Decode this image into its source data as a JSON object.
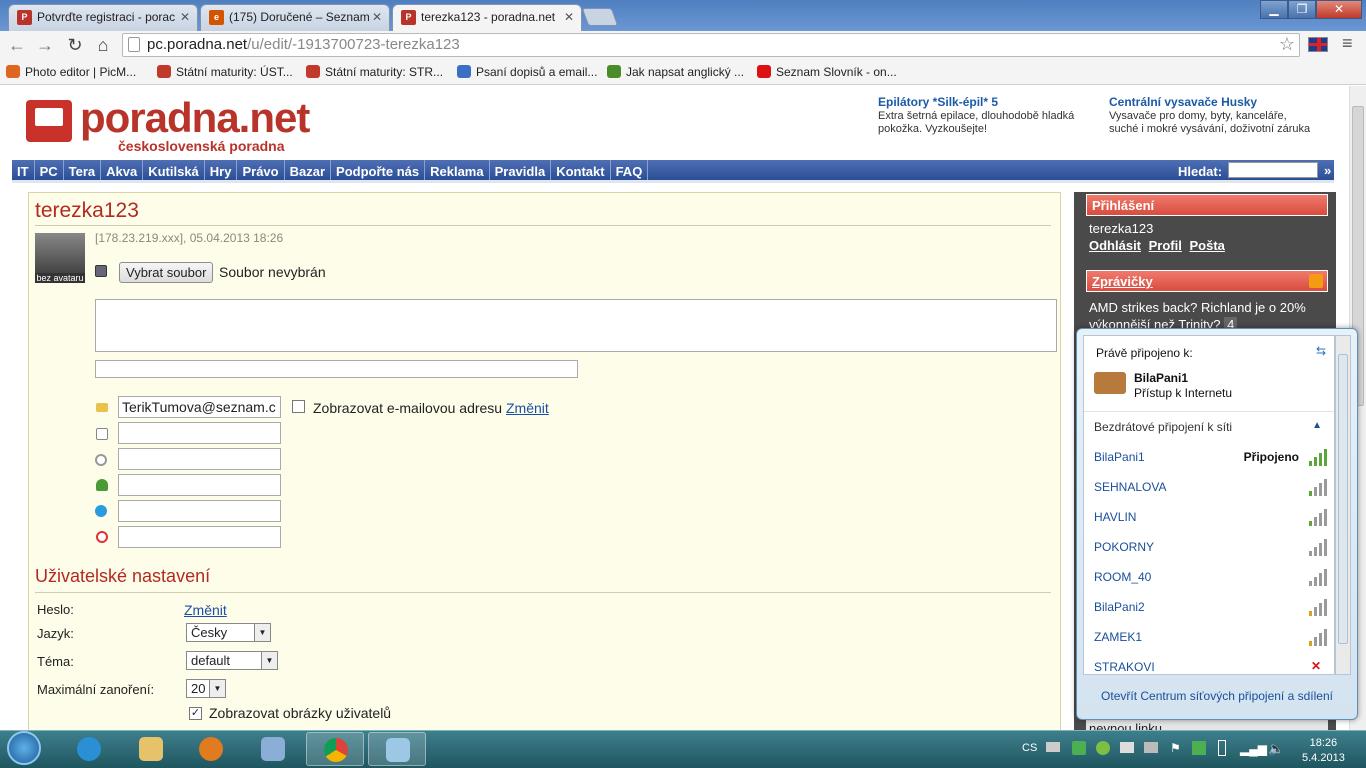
{
  "browser": {
    "tabs": [
      {
        "title": "Potvrďte registraci - porac",
        "icon": "poradna-favicon",
        "icon_color": "#b8332a"
      },
      {
        "title": "(175) Doručené – Seznam",
        "icon": "seznam-email-favicon",
        "icon_color": "#d35400"
      },
      {
        "title": "terezka123 - poradna.net",
        "icon": "poradna-favicon",
        "icon_color": "#b8332a"
      }
    ],
    "url_domain": "pc.poradna.net",
    "url_path": "/u/edit/-1913700723-terezka123",
    "bookmarks": [
      {
        "label": "Photo editor | PicM...",
        "icon_color": "#e0661f"
      },
      {
        "label": "Státní maturity: ÚST...",
        "icon_color": "#c0392b"
      },
      {
        "label": "Státní maturity: STR...",
        "icon_color": "#c0392b"
      },
      {
        "label": "Psaní dopisů a email...",
        "icon_color": "#3a6fc4"
      },
      {
        "label": "Jak napsat anglický ...",
        "icon_color": "#4a8c2a"
      },
      {
        "label": "Seznam Slovník - on...",
        "icon_color": "#d11"
      }
    ]
  },
  "site": {
    "logo_title": "poradna.net",
    "logo_subtitle": "československá poradna",
    "ads": [
      {
        "title": "Epilátory *Silk-épil* 5",
        "text": "Extra šetrná epilace, dlouhodobě hladká pokožka. Vyzkoušejte!"
      },
      {
        "title": "Centrální vysavače Husky",
        "text": "Vysavače pro domy, byty, kanceláře, suché i mokré vysávání, doživotní záruka"
      }
    ],
    "menu": [
      "IT",
      "PC",
      "Tera",
      "Akva",
      "Kutilská",
      "Hry",
      "Právo",
      "Bazar",
      "Podpořte nás",
      "Reklama",
      "Pravidla",
      "Kontakt",
      "FAQ"
    ],
    "search_label": "Hledat:",
    "search_go": "»"
  },
  "profile": {
    "username": "terezka123",
    "meta": "[178.23.219.xxx], 05.04.2013 18:26",
    "avatar_label": "bez avataru",
    "file_button": "Vybrat soubor",
    "file_status": "Soubor nevybrán",
    "email_value": "TerikTumova@seznam.c",
    "show_email_label": "Zobrazovat e-mailovou adresu",
    "change_link": "Změnit"
  },
  "settings": {
    "heading": "Uživatelské nastavení",
    "password_label": "Heslo:",
    "password_link": "Změnit",
    "language_label": "Jazyk:",
    "language_value": "Česky",
    "theme_label": "Téma:",
    "theme_value": "default",
    "depth_label": "Maximální zanoření:",
    "depth_value": "20",
    "show_images_label": "Zobrazovat obrázky uživatelů"
  },
  "sidebar": {
    "login_head": "Přihlášení",
    "login_user": "terezka123",
    "logout": "Odhlásit",
    "profile": "Profil",
    "mail": "Pošta",
    "news_head": "Zprávičky",
    "news_item": "AMD strikes back? Richland je o 20% výkonnější než Trinity?",
    "news_count": "4",
    "hidden_link": "nevnou linku"
  },
  "network": {
    "connected_to": "Právě připojeno k:",
    "current_name": "BilaPani1",
    "current_status": "Přístup k Internetu",
    "section": "Bezdrátové připojení k síti",
    "networks": [
      {
        "name": "BilaPani1",
        "status": "Připojeno",
        "signal": 5,
        "secured": true
      },
      {
        "name": "SEHNALOVA",
        "status": "",
        "signal": 3,
        "secured": false
      },
      {
        "name": "HAVLIN",
        "status": "",
        "signal": 2,
        "secured": false
      },
      {
        "name": "POKORNY",
        "status": "",
        "signal": 1,
        "secured": false
      },
      {
        "name": "ROOM_40",
        "status": "",
        "signal": 1,
        "secured": false
      },
      {
        "name": "BilaPani2",
        "status": "",
        "signal": 1,
        "secured": true
      },
      {
        "name": "ZAMEK1",
        "status": "",
        "signal": 1,
        "secured": true
      },
      {
        "name": "STRAKOVI",
        "status": "",
        "signal": 0,
        "secured": false
      }
    ],
    "footer": "Otevřít Centrum síťových připojení a sdílení"
  },
  "taskbar": {
    "lang": "CS",
    "time": "18:26",
    "date": "5.4.2013"
  }
}
